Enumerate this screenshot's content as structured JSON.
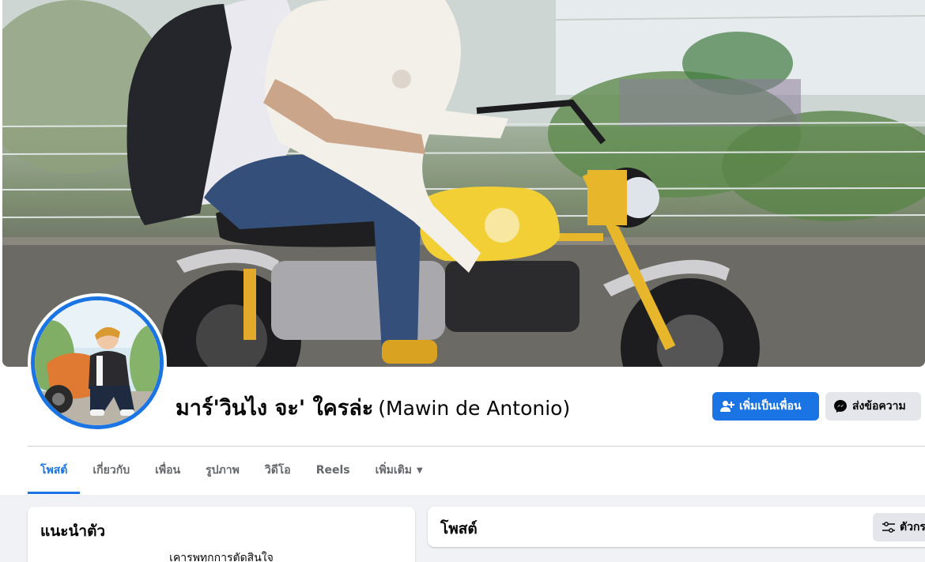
{
  "profile": {
    "name": "มาร์'วินไง จะ' ใครล่ะ",
    "alternate_name": "(Mawin de Antonio)"
  },
  "actions": {
    "add_friend_label": "เพิ่มเป็นเพื่อน",
    "message_label": "ส่งข้อความ"
  },
  "tabs": [
    {
      "label": "โพสต์",
      "active": true
    },
    {
      "label": "เกี่ยวกับ"
    },
    {
      "label": "เพื่อน"
    },
    {
      "label": "รูปภาพ"
    },
    {
      "label": "วิดีโอ"
    },
    {
      "label": "Reels"
    },
    {
      "label": "เพิ่มเติม"
    }
  ],
  "intro": {
    "title": "แนะนำตัว",
    "bio": "เคารพทุกการตัดสินใจ"
  },
  "posts": {
    "title": "โพสต์",
    "filter_label": "ตัวกรอง"
  },
  "colors": {
    "accent": "#1b74e4",
    "secondary_button": "#e4e6eb",
    "page_background": "#f0f2f5"
  },
  "icons": {
    "add_friend": "user-plus-icon",
    "message": "messenger-icon",
    "more_caret": "caret-down-icon",
    "filter": "sliders-icon"
  }
}
